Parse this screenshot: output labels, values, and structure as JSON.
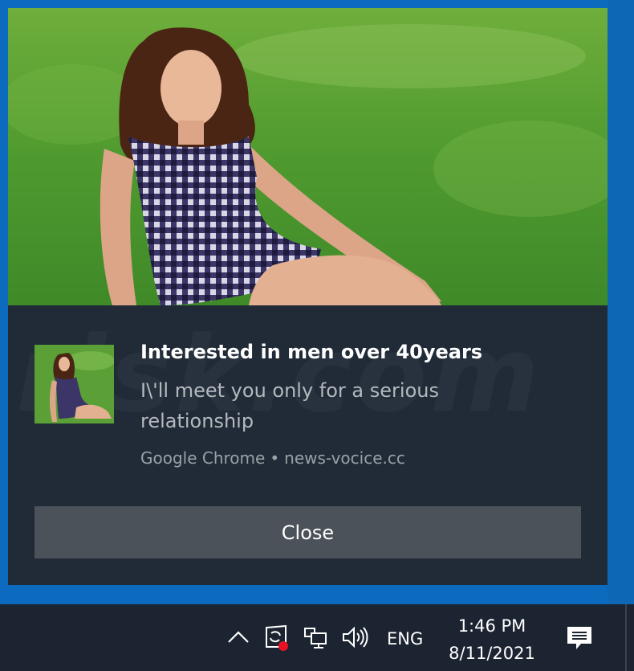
{
  "notification": {
    "title": "Interested in men over 40years",
    "message": "I\\'ll meet you only for a serious relationship",
    "app_name": "Google Chrome",
    "separator": "•",
    "site": "news-vocice.cc",
    "close_label": "Close"
  },
  "taskbar": {
    "language": "ENG",
    "time": "1:46 PM",
    "date": "8/11/2021",
    "icons": [
      "chevron-up-icon",
      "windows-security-icon",
      "network-icon",
      "volume-icon",
      "action-center-icon"
    ]
  },
  "colors": {
    "desktop": "#0d6bbf",
    "toast_bg": "#202b37",
    "button_bg": "#4b525a",
    "taskbar_bg": "#1b2430"
  }
}
